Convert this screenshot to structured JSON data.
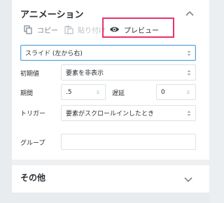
{
  "animation": {
    "title": "アニメーション",
    "actions": {
      "copy_label": "コピー",
      "paste_label": "貼り付け",
      "preview_label": "プレビュー"
    },
    "effect": {
      "value": "スライド (左から右)"
    },
    "initial_state": {
      "label": "初期値",
      "value": "要素を非表示"
    },
    "duration": {
      "label": "期間",
      "value": ".5",
      "unit": "s"
    },
    "delay": {
      "label": "遅延",
      "value": "0",
      "unit": "s"
    },
    "trigger": {
      "label": "トリガー",
      "value": "要素がスクロールインしたとき"
    },
    "group": {
      "label": "グループ",
      "value": ""
    }
  },
  "other": {
    "title": "その他"
  },
  "colors": {
    "highlight": "#e8336b",
    "active_border": "#58a7de"
  }
}
